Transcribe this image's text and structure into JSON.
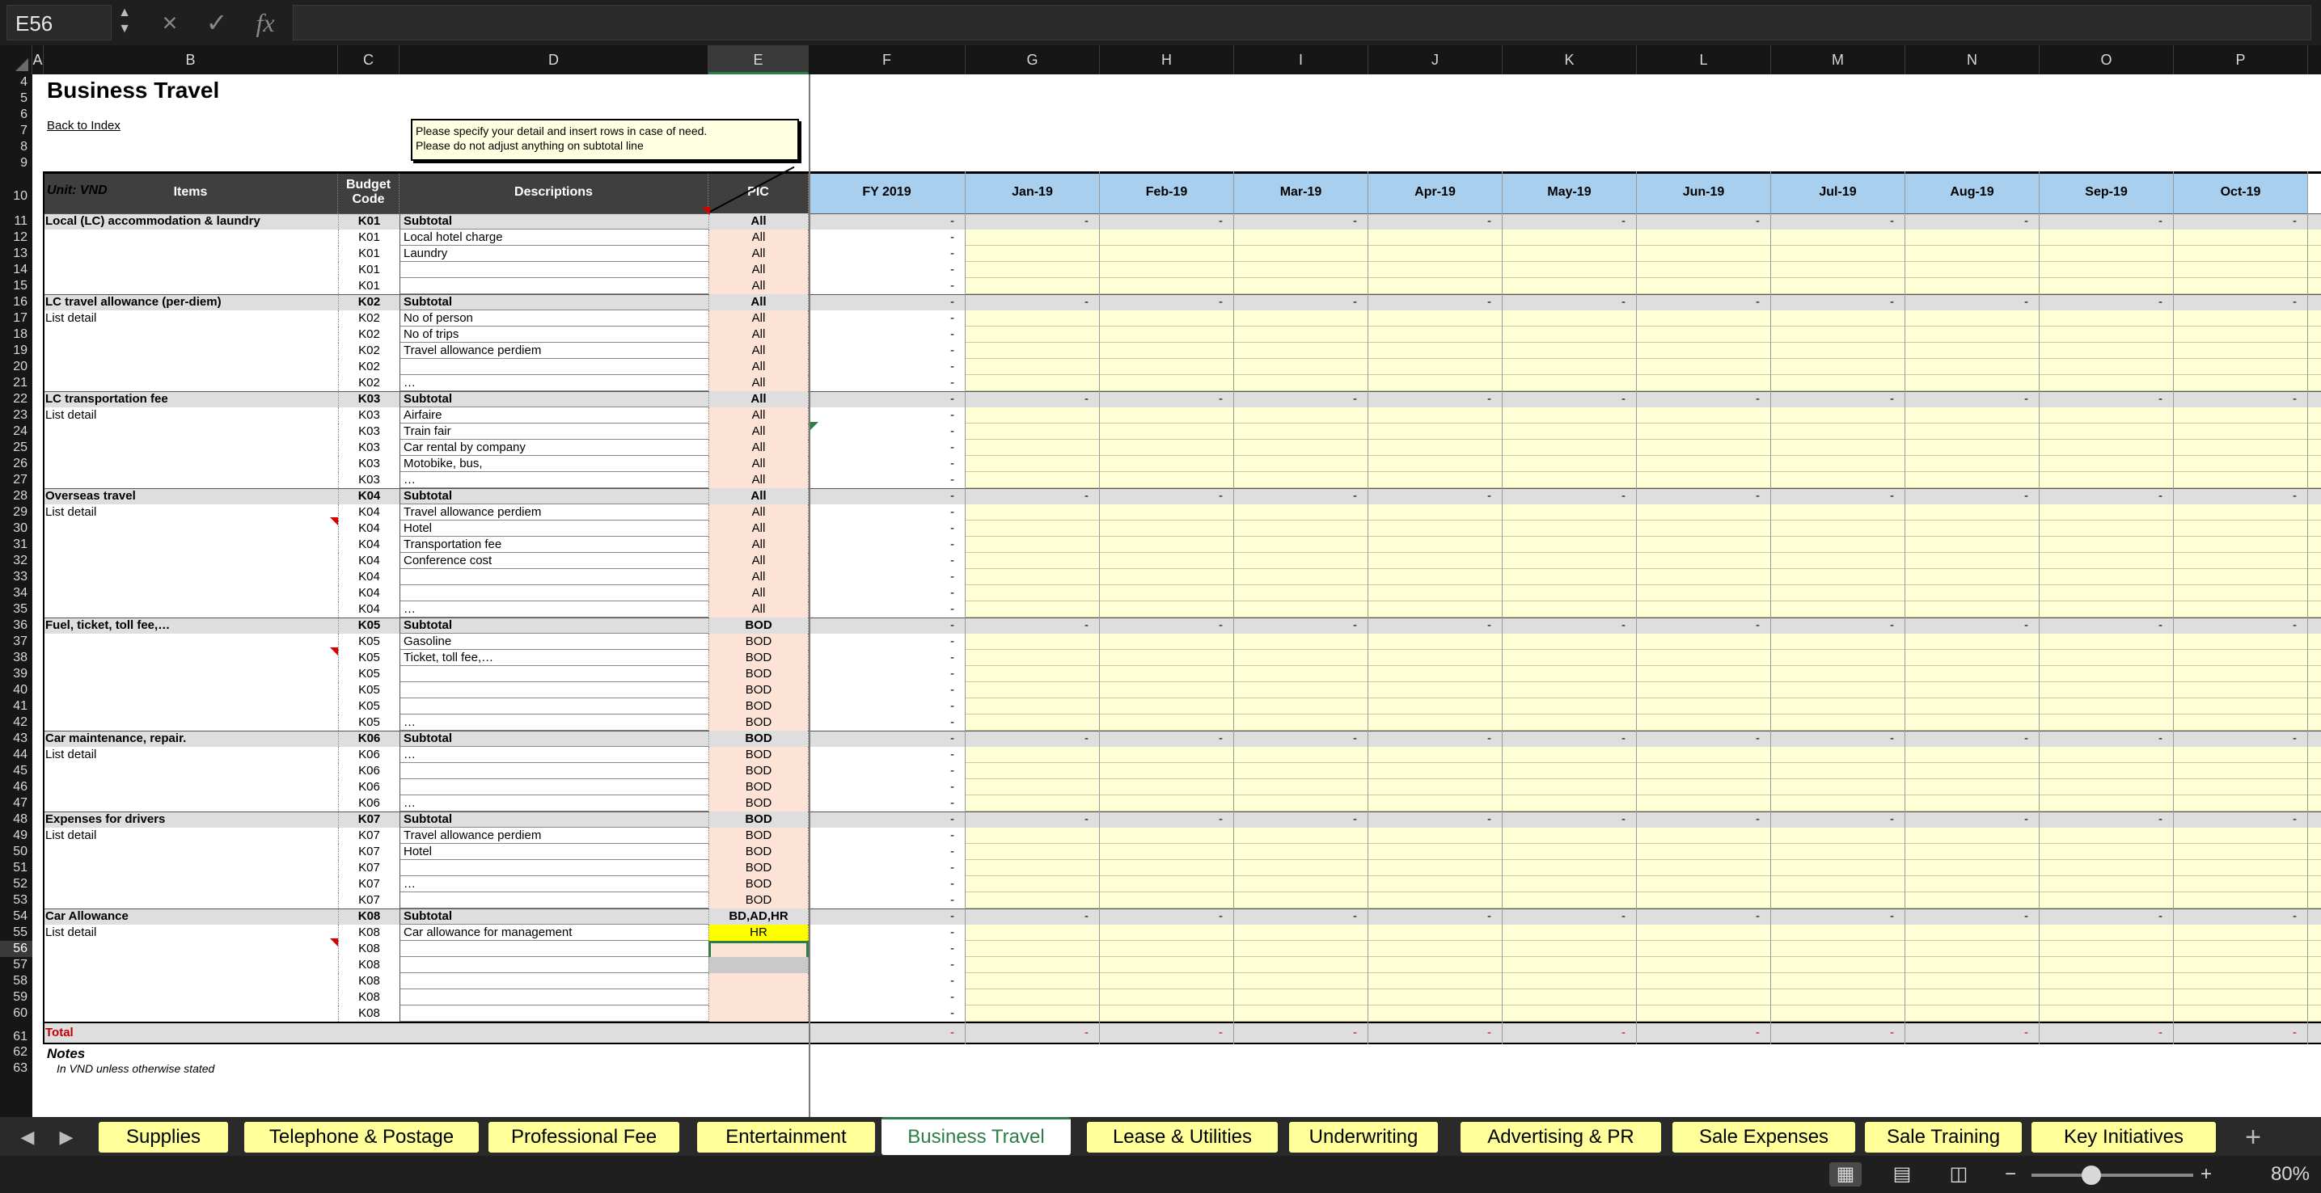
{
  "formula_bar": {
    "name_box": "E56",
    "cancel_icon": "×",
    "confirm_icon": "✓",
    "fx_label": "fx",
    "formula": ""
  },
  "columns": [
    {
      "label": "A"
    },
    {
      "label": "B"
    },
    {
      "label": "C"
    },
    {
      "label": "D"
    },
    {
      "label": "E",
      "selected": true
    },
    {
      "label": "F"
    },
    {
      "label": "G"
    },
    {
      "label": "H"
    },
    {
      "label": "I"
    },
    {
      "label": "J"
    },
    {
      "label": "K"
    },
    {
      "label": "L"
    },
    {
      "label": "M"
    },
    {
      "label": "N"
    },
    {
      "label": "O"
    },
    {
      "label": "P"
    }
  ],
  "sheet": {
    "title": "Business Travel",
    "back_link": "Back to Index",
    "note_line1": "Please specify your detail and insert rows in case of need.",
    "note_line2": "Please do not adjust anything on subtotal line",
    "unit": "Unit: VND",
    "headers": {
      "items": "Items",
      "budget_code": "Budget Code",
      "descriptions": "Descriptions",
      "pic": "PIC"
    },
    "months": [
      "FY 2019",
      "Jan-19",
      "Feb-19",
      "Mar-19",
      "Apr-19",
      "May-19",
      "Jun-19",
      "Jul-19",
      "Aug-19",
      "Sep-19",
      "Oct-19"
    ],
    "notes_title": "Notes",
    "notes_line": "In VND unless otherwise stated"
  },
  "colors": {
    "accent": "#2f7d46",
    "month_header": "#a8cfee",
    "tab": "#ffff99",
    "input_fill": "#ffffd6",
    "pic_fill": "#fde3d6",
    "subtotal_fill": "#dedede"
  },
  "rows": [
    {
      "num": "4",
      "h": 20
    },
    {
      "num": "5",
      "h": 20
    },
    {
      "num": "6",
      "h": 20
    },
    {
      "num": "7",
      "h": 20
    },
    {
      "num": "8",
      "h": 20
    },
    {
      "num": "9",
      "h": 20
    },
    {
      "num": "10",
      "h": 52,
      "type": "header"
    },
    {
      "num": "11",
      "type": "subtotal",
      "item": "Local (LC) accommodation & laundry",
      "code": "K01",
      "desc": "Subtotal",
      "pic": "All"
    },
    {
      "num": "12",
      "code": "K01",
      "desc": "Local hotel charge",
      "pic": "All"
    },
    {
      "num": "13",
      "code": "K01",
      "desc": "Laundry",
      "pic": "All"
    },
    {
      "num": "14",
      "code": "K01",
      "desc": "",
      "pic": "All"
    },
    {
      "num": "15",
      "code": "K01",
      "desc": "",
      "pic": "All"
    },
    {
      "num": "16",
      "type": "subtotal",
      "item": "LC travel allowance (per-diem)",
      "code": "K02",
      "desc": "Subtotal",
      "pic": "All"
    },
    {
      "num": "17",
      "item": "List detail",
      "code": "K02",
      "desc": "No of person",
      "pic": "All"
    },
    {
      "num": "18",
      "code": "K02",
      "desc": "No of trips",
      "pic": "All"
    },
    {
      "num": "19",
      "code": "K02",
      "desc": "Travel allowance perdiem",
      "pic": "All"
    },
    {
      "num": "20",
      "code": "K02",
      "desc": "",
      "pic": "All"
    },
    {
      "num": "21",
      "code": "K02",
      "desc": "…",
      "pic": "All"
    },
    {
      "num": "22",
      "type": "subtotal",
      "item": "LC transportation fee",
      "code": "K03",
      "desc": "Subtotal",
      "pic": "All"
    },
    {
      "num": "23",
      "item": "List detail",
      "code": "K03",
      "desc": "Airfaire",
      "pic": "All"
    },
    {
      "num": "24",
      "code": "K03",
      "desc": "Train fair",
      "pic": "All"
    },
    {
      "num": "25",
      "code": "K03",
      "desc": "Car rental by company",
      "pic": "All"
    },
    {
      "num": "26",
      "code": "K03",
      "desc": "Motobike, bus,",
      "pic": "All"
    },
    {
      "num": "27",
      "code": "K03",
      "desc": "…",
      "pic": "All"
    },
    {
      "num": "28",
      "type": "subtotal",
      "item": "Overseas travel",
      "code": "K04",
      "desc": "Subtotal",
      "pic": "All"
    },
    {
      "num": "29",
      "item": "List detail",
      "code": "K04",
      "desc": "Travel allowance perdiem",
      "pic": "All"
    },
    {
      "num": "30",
      "code": "K04",
      "desc": "Hotel",
      "pic": "All"
    },
    {
      "num": "31",
      "code": "K04",
      "desc": "Transportation fee",
      "pic": "All"
    },
    {
      "num": "32",
      "code": "K04",
      "desc": "Conference cost",
      "pic": "All"
    },
    {
      "num": "33",
      "code": "K04",
      "desc": "",
      "pic": "All"
    },
    {
      "num": "34",
      "code": "K04",
      "desc": "",
      "pic": "All"
    },
    {
      "num": "35",
      "code": "K04",
      "desc": "…",
      "pic": "All"
    },
    {
      "num": "36",
      "type": "subtotal",
      "item": "Fuel, ticket, toll fee,…",
      "code": "K05",
      "desc": "Subtotal",
      "pic": "BOD"
    },
    {
      "num": "37",
      "code": "K05",
      "desc": "Gasoline",
      "pic": "BOD"
    },
    {
      "num": "38",
      "code": "K05",
      "desc": "Ticket, toll fee,…",
      "pic": "BOD"
    },
    {
      "num": "39",
      "code": "K05",
      "desc": "",
      "pic": "BOD"
    },
    {
      "num": "40",
      "code": "K05",
      "desc": "",
      "pic": "BOD"
    },
    {
      "num": "41",
      "code": "K05",
      "desc": "",
      "pic": "BOD"
    },
    {
      "num": "42",
      "code": "K05",
      "desc": "…",
      "pic": "BOD"
    },
    {
      "num": "43",
      "type": "subtotal",
      "item": "Car maintenance, repair.",
      "code": "K06",
      "desc": "Subtotal",
      "pic": "BOD"
    },
    {
      "num": "44",
      "item": "List detail",
      "code": "K06",
      "desc": "…",
      "pic": "BOD"
    },
    {
      "num": "45",
      "code": "K06",
      "desc": "",
      "pic": "BOD"
    },
    {
      "num": "46",
      "code": "K06",
      "desc": "",
      "pic": "BOD"
    },
    {
      "num": "47",
      "code": "K06",
      "desc": "…",
      "pic": "BOD"
    },
    {
      "num": "48",
      "type": "subtotal",
      "item": "Expenses for drivers",
      "code": "K07",
      "desc": "Subtotal",
      "pic": "BOD"
    },
    {
      "num": "49",
      "item": "List detail",
      "code": "K07",
      "desc": "Travel allowance perdiem",
      "pic": "BOD"
    },
    {
      "num": "50",
      "code": "K07",
      "desc": "Hotel",
      "pic": "BOD"
    },
    {
      "num": "51",
      "code": "K07",
      "desc": "",
      "pic": "BOD"
    },
    {
      "num": "52",
      "code": "K07",
      "desc": "…",
      "pic": "BOD"
    },
    {
      "num": "53",
      "code": "K07",
      "desc": "",
      "pic": "BOD"
    },
    {
      "num": "54",
      "type": "subtotal",
      "item": "Car Allowance",
      "code": "K08",
      "desc": "Subtotal",
      "pic": "BD,AD,HR"
    },
    {
      "num": "55",
      "item": "List detail",
      "code": "K08",
      "desc": "Car allowance for management",
      "pic": "HR",
      "pic_highlight": "#ffff00"
    },
    {
      "num": "56",
      "code": "K08",
      "desc": "",
      "pic": "",
      "selected": true
    },
    {
      "num": "57",
      "code": "K08",
      "desc": "",
      "pic": "",
      "pic_highlight": "#c9c9c9"
    },
    {
      "num": "58",
      "code": "K08",
      "desc": "",
      "pic": ""
    },
    {
      "num": "59",
      "code": "K08",
      "desc": "",
      "pic": ""
    },
    {
      "num": "60",
      "code": "K08",
      "desc": "",
      "pic": ""
    },
    {
      "num": "61",
      "h": 28,
      "type": "total",
      "item": "Total"
    },
    {
      "num": "62",
      "h": 20,
      "type": "notes"
    },
    {
      "num": "63",
      "h": 20,
      "type": "notes2"
    }
  ],
  "dash": "-",
  "tabs": [
    "Supplies",
    "Telephone & Postage",
    "Professional Fee",
    "Entertainment",
    "Business Travel",
    "Lease & Utilities",
    "Underwriting",
    "Advertising & PR",
    "Sale Expenses",
    "Sale Training",
    "Key Initiatives"
  ],
  "active_tab": "Business Travel",
  "add_sheet_label": "+",
  "zoom": "80%"
}
